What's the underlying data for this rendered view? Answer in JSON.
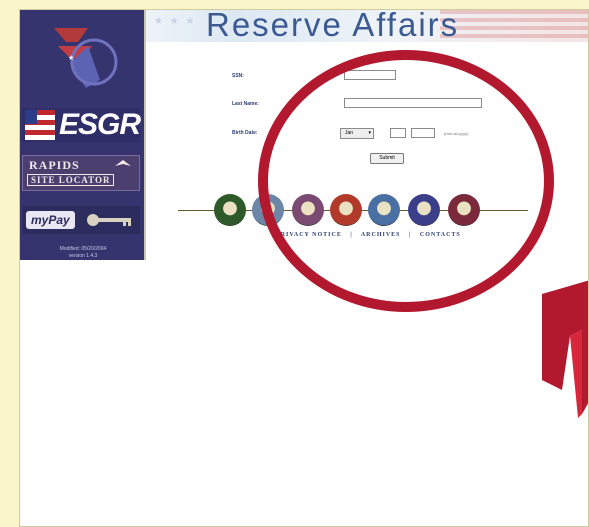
{
  "header": {
    "title": "Reserve Affairs",
    "stars": "★ ★ ★"
  },
  "sidebar": {
    "esgr_label": "ESGR",
    "rapids_line1": "RAPIDS",
    "rapids_line2": "SITE LOCATOR",
    "mypay_label": "myPay",
    "footer_line1": "Modified: 05/20/2004",
    "footer_line2": "version 1.4.3"
  },
  "form": {
    "ssn_label": "SSN:",
    "lastname_label": "Last Name:",
    "birthdate_label": "Birth Date:",
    "month_value": "Jan",
    "year_hint": "(mm-dd-yyyy)",
    "submit_label": "Submit"
  },
  "links": [
    "PRIVACY NOTICE",
    "|",
    "ARCHIVES",
    "|",
    "CONTACTS"
  ],
  "seals": [
    {
      "name": "army-seal-icon",
      "color": "#2e5a2a"
    },
    {
      "name": "navy-seal-icon",
      "color": "#6b86a6"
    },
    {
      "name": "marines-seal-icon",
      "color": "#7b4a72"
    },
    {
      "name": "marine-corps-reserve-seal-icon",
      "color": "#b23a2a"
    },
    {
      "name": "air-force-seal-icon",
      "color": "#4a6fa3"
    },
    {
      "name": "air-national-guard-seal-icon",
      "color": "#3b3f8a"
    },
    {
      "name": "coast-guard-seal-icon",
      "color": "#7a2a3a"
    }
  ],
  "colors": {
    "page_background": "#fbf6c9",
    "accent_red": "#b2192e",
    "sidebar": "#35346e"
  }
}
